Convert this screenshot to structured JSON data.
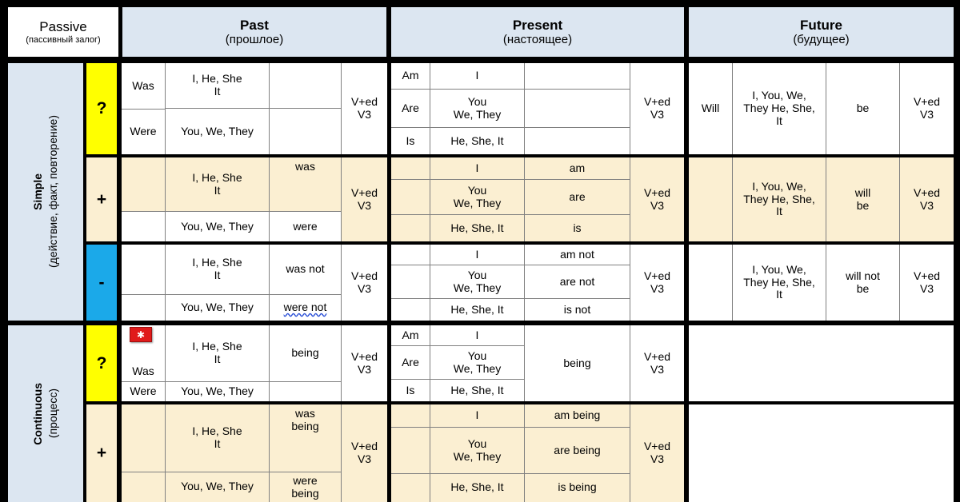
{
  "corner": {
    "title_en": "Passive",
    "title_ru": "(пассивный залог)"
  },
  "tense_headers": [
    {
      "en": "Past",
      "ru": "(прошлое)"
    },
    {
      "en": "Present",
      "ru": "(настоящее)"
    },
    {
      "en": "Future",
      "ru": "(будущее)"
    }
  ],
  "aspects": [
    {
      "en": "Simple",
      "ru": "(действие, факт, повторение)"
    },
    {
      "en": "Continuous",
      "ru": "(процесс)"
    }
  ],
  "signs": {
    "question": "?",
    "positive": "+",
    "negative": "-"
  },
  "verb_form": "V+ed\nV3",
  "comment_marker": "✱",
  "simple": {
    "question": {
      "past": {
        "aux": [
          "Was",
          "Were"
        ],
        "subjects": [
          "I, He, She\nIt",
          "You, We, They"
        ],
        "middle": [
          "",
          ""
        ],
        "form": "V+ed\nV3"
      },
      "present": {
        "aux": [
          "Am",
          "Are",
          "Is"
        ],
        "subjects": [
          "I",
          "You\nWe, They",
          "He, She, It"
        ],
        "middle": [
          "",
          "",
          ""
        ],
        "form": "V+ed\nV3"
      },
      "future": {
        "aux": "Will",
        "subjects": "I, You, We,\nThey He, She,\nIt",
        "middle": "be",
        "form": "V+ed\nV3"
      }
    },
    "positive": {
      "past": {
        "aux": [
          "",
          ""
        ],
        "subjects": [
          "I, He, She\nIt",
          "You, We, They"
        ],
        "middle": [
          "was",
          "were"
        ],
        "form": "V+ed\nV3"
      },
      "present": {
        "aux": [
          "",
          "",
          ""
        ],
        "subjects": [
          "I",
          "You\nWe, They",
          "He, She, It"
        ],
        "middle": [
          "am",
          "are",
          "is"
        ],
        "form": "V+ed\nV3"
      },
      "future": {
        "aux": "",
        "subjects": "I, You, We,\nThey He, She,\nIt",
        "middle": "will\nbe",
        "form": "V+ed\nV3"
      }
    },
    "negative": {
      "past": {
        "aux": [
          "",
          ""
        ],
        "subjects": [
          "I, He, She\nIt",
          "You, We, They"
        ],
        "middle": [
          "was not",
          "were not"
        ],
        "form": "V+ed\nV3"
      },
      "present": {
        "aux": [
          "",
          "",
          ""
        ],
        "subjects": [
          "I",
          "You\nWe, They",
          "He, She, It"
        ],
        "middle": [
          "am not",
          "are not",
          "is not"
        ],
        "form": "V+ed\nV3"
      },
      "future": {
        "aux": "",
        "subjects": "I, You, We,\nThey He, She,\nIt",
        "middle": "will not\nbe",
        "form": "V+ed\nV3"
      }
    }
  },
  "continuous": {
    "question": {
      "past": {
        "aux": [
          "Was",
          "Were"
        ],
        "subjects": [
          "I, He, She\nIt",
          "You, We, They"
        ],
        "middle": [
          "being",
          ""
        ],
        "form": "V+ed\nV3"
      },
      "present": {
        "aux": [
          "Am",
          "Are",
          "Is"
        ],
        "subjects": [
          "I",
          "You\nWe, They",
          "He, She, It"
        ],
        "middle": "being",
        "form": "V+ed\nV3"
      },
      "future": {
        "aux": "",
        "subjects": "",
        "middle": "",
        "form": ""
      }
    },
    "positive": {
      "past": {
        "aux": [
          "",
          ""
        ],
        "subjects": [
          "I, He, She\nIt",
          "You, We, They"
        ],
        "middle": [
          "was\nbeing",
          "were\nbeing"
        ],
        "form": "V+ed\nV3"
      },
      "present": {
        "aux": [
          "",
          "",
          ""
        ],
        "subjects": [
          "I",
          "You\nWe, They",
          "He, She, It"
        ],
        "middle": [
          "am  being",
          "are  being",
          "is  being"
        ],
        "form": "V+ed\nV3"
      },
      "future": {
        "aux": "",
        "subjects": "",
        "middle": "",
        "form": ""
      }
    }
  },
  "colors": {
    "header_blue": "#DCE6F1",
    "beige": "#FBEFD2",
    "yellow": "#FFFF00",
    "cyan": "#1BA9E9",
    "badge_red": "#E01B1B",
    "gridline": "#000000"
  }
}
